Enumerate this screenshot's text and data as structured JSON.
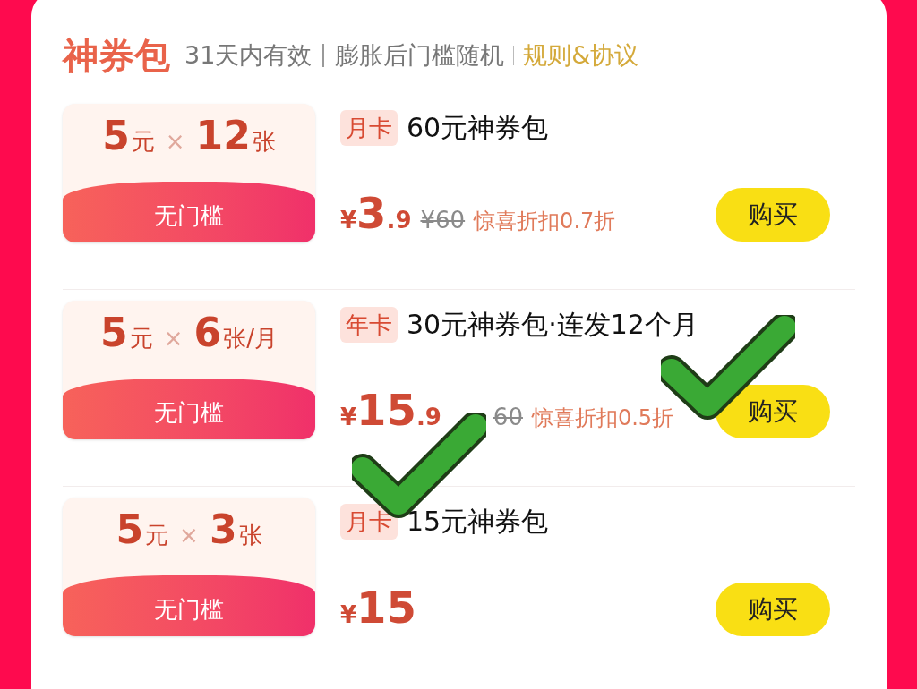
{
  "header": {
    "title": "神券包",
    "notes": [
      "31天内有效",
      "膨胀后门槛随机"
    ],
    "link": "规则&协议"
  },
  "packages": [
    {
      "coupon": {
        "amount": "5",
        "amount_unit": "元",
        "times": "×",
        "count": "12",
        "count_unit": "张"
      },
      "threshold": "无门槛",
      "tag": "月卡",
      "title": "60元神券包",
      "price": {
        "currency": "¥",
        "integer": "3",
        "decimal": ".9"
      },
      "original_price": "¥60",
      "discount": "惊喜折扣0.7折",
      "button": "购买"
    },
    {
      "coupon": {
        "amount": "5",
        "amount_unit": "元",
        "times": "×",
        "count": "6",
        "count_unit": "张/月"
      },
      "threshold": "无门槛",
      "tag": "年卡",
      "title": "30元神券包·连发12个月",
      "price": {
        "currency": "¥",
        "integer": "15",
        "decimal": ".9"
      },
      "original_price": "60",
      "original_price_covered": true,
      "discount": "惊喜折扣0.5折",
      "button": "购买"
    },
    {
      "coupon": {
        "amount": "5",
        "amount_unit": "元",
        "times": "×",
        "count": "3",
        "count_unit": "张"
      },
      "threshold": "无门槛",
      "tag": "月卡",
      "title": "15元神券包",
      "price": {
        "currency": "¥",
        "integer": "15"
      },
      "button": "购买"
    }
  ],
  "annotations": [
    {
      "kind": "check"
    },
    {
      "kind": "check"
    }
  ]
}
